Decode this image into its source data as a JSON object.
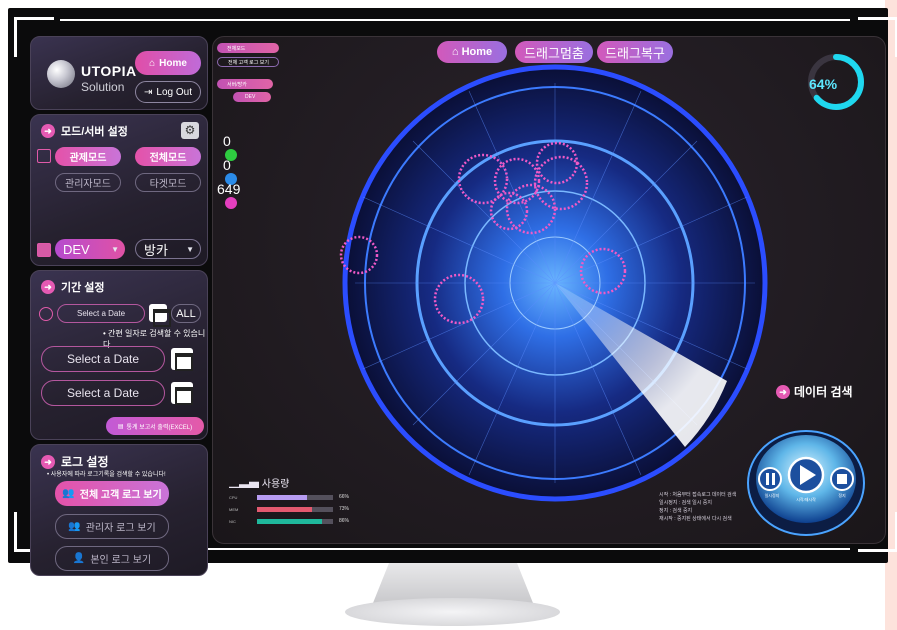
{
  "brand": {
    "title": "UTOPIA",
    "subtitle": "Solution"
  },
  "header": {
    "home_label": "Home",
    "logout_label": "Log Out"
  },
  "mode_settings": {
    "title": "모드/서버 설정",
    "modes": [
      "관제모드",
      "전체모드",
      "관리자모드",
      "타겟모드"
    ],
    "server_select": "DEV",
    "room_select": "방카"
  },
  "period_settings": {
    "title": "기간 설정",
    "quick_date_placeholder": "Select a Date",
    "all_label": "ALL",
    "hint": "• 간편 일자로 검색할 수 있습니다.",
    "start_date_placeholder": "Select a Date",
    "end_date_placeholder": "Select a Date",
    "report_button": "통계 보고서 출력(EXCEL)"
  },
  "log_settings": {
    "title": "로그 설정",
    "hint": "• 사용자에 따라 로그기록을 검색할 수 있습니다!",
    "buttons": [
      "전체 고객 로그 보기",
      "관리자 로그 보기",
      "본인 로그 보기"
    ]
  },
  "main": {
    "mini_tags": [
      "전체모드",
      "전체 고객 로그 보기",
      "서버/방카",
      "DEV"
    ],
    "top_buttons": [
      "Home",
      "드래그멈춤",
      "드래그복구"
    ],
    "counts": [
      "0",
      "0",
      "649"
    ],
    "count_colors": [
      "#2ecc40",
      "#2b8be8",
      "#e53fbf"
    ],
    "gauge_percent": 64,
    "gauge_text": "64%",
    "search_label": "데이터 검색",
    "usage_title": "사용량",
    "usage": [
      {
        "name": "CPU",
        "value": 0.66,
        "color": "#b79cf2",
        "text": "66%"
      },
      {
        "name": "MEM",
        "value": 0.73,
        "color": "#e3596f",
        "text": "73%"
      },
      {
        "name": "NIC",
        "value": 0.86,
        "color": "#1fb89c",
        "text": "86%"
      }
    ],
    "legend_lines": [
      "시작 : 처음부터 접속로그 데이터 검색",
      "일시정지 : 검색 일시 중지",
      "정지 : 검색 중지",
      "재시작 : 중지된 상태에서 다시 검색"
    ],
    "control_labels": {
      "pause": "일시정지",
      "play": "시작/재시작",
      "stop": "정지"
    }
  },
  "colors": {
    "accent_pink": "#e452a9",
    "accent_purple": "#c974d8",
    "radar_blue": "#2a6cff",
    "gauge_cyan": "#1fd8ef"
  }
}
